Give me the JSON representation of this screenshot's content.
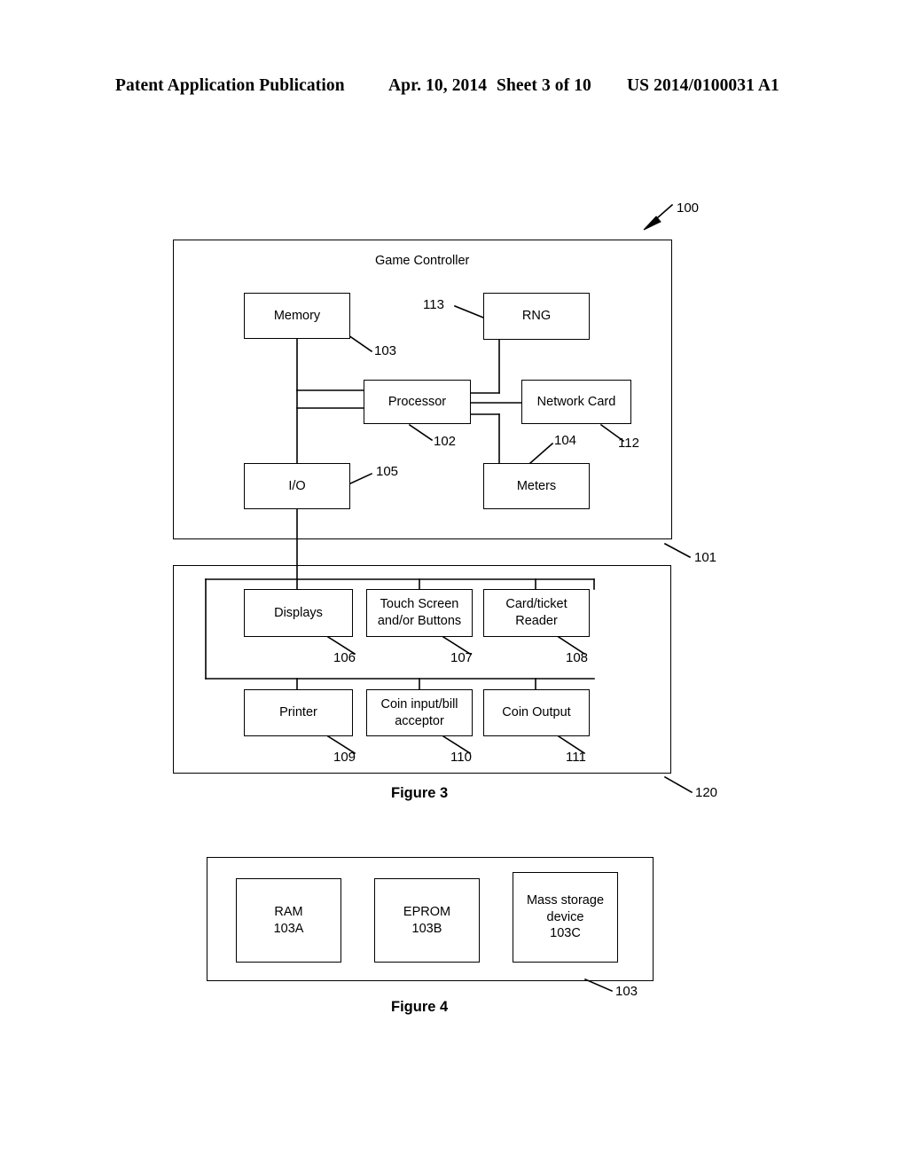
{
  "header": {
    "publication": "Patent Application Publication",
    "date": "Apr. 10, 2014",
    "sheet": "Sheet 3 of 10",
    "number": "US 2014/0100031 A1"
  },
  "figure3": {
    "caption": "Figure 3",
    "system_ref": "100",
    "controller_ref": "101",
    "peripherals_ref": "120",
    "controller_title": "Game Controller",
    "blocks": [
      {
        "label": "Memory",
        "ref": "103"
      },
      {
        "label": "RNG",
        "ref": "113"
      },
      {
        "label": "Processor",
        "ref": "102"
      },
      {
        "label": "Network Card",
        "ref": "112"
      },
      {
        "label": "I/O",
        "ref": "105"
      },
      {
        "label": "Meters",
        "ref": "104"
      },
      {
        "label": "Displays",
        "ref": "106"
      },
      {
        "label_line1": "Touch Screen",
        "label_line2": "and/or Buttons",
        "ref": "107"
      },
      {
        "label_line1": "Card/ticket",
        "label_line2": "Reader",
        "ref": "108"
      },
      {
        "label": "Printer",
        "ref": "109"
      },
      {
        "label_line1": "Coin input/bill",
        "label_line2": "acceptor",
        "ref": "110"
      },
      {
        "label": "Coin Output",
        "ref": "111"
      }
    ]
  },
  "figure4": {
    "caption": "Figure 4",
    "memory_ref": "103",
    "blocks": [
      {
        "label_line1": "RAM",
        "label_line2": "103A"
      },
      {
        "label_line1": "EPROM",
        "label_line2": "103B"
      },
      {
        "label_line1": "Mass storage",
        "label_line2": "device",
        "label_line3": "103C"
      }
    ]
  }
}
